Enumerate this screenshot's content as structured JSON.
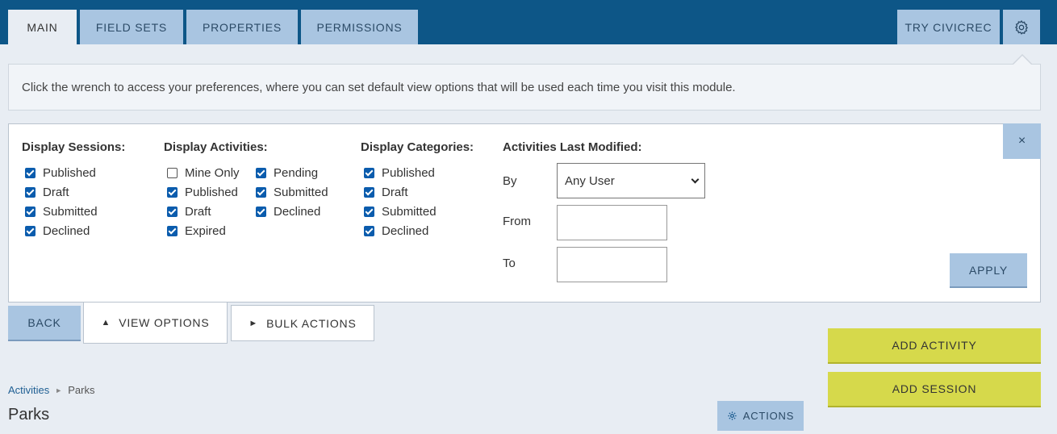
{
  "tabs": [
    {
      "label": "MAIN"
    },
    {
      "label": "FIELD SETS"
    },
    {
      "label": "PROPERTIES"
    },
    {
      "label": "PERMISSIONS"
    }
  ],
  "header": {
    "try_label": "TRY CIVICREC",
    "settings_icon": "gear-icon"
  },
  "notice": {
    "text": "Click the wrench to access your preferences, where you can set default view options that will be used each time you visit this module."
  },
  "view_options": {
    "close_label": "×",
    "sessions": {
      "title": "Display Sessions:",
      "items": [
        {
          "label": "Published",
          "checked": true
        },
        {
          "label": "Draft",
          "checked": true
        },
        {
          "label": "Submitted",
          "checked": true
        },
        {
          "label": "Declined",
          "checked": true
        }
      ]
    },
    "activities": {
      "title": "Display Activities:",
      "col1": [
        {
          "label": "Mine Only",
          "checked": false
        },
        {
          "label": "Published",
          "checked": true
        },
        {
          "label": "Draft",
          "checked": true
        },
        {
          "label": "Expired",
          "checked": true
        }
      ],
      "col2": [
        {
          "label": "Pending",
          "checked": true
        },
        {
          "label": "Submitted",
          "checked": true
        },
        {
          "label": "Declined",
          "checked": true
        }
      ]
    },
    "categories": {
      "title": "Display Categories:",
      "items": [
        {
          "label": "Published",
          "checked": true
        },
        {
          "label": "Draft",
          "checked": true
        },
        {
          "label": "Submitted",
          "checked": true
        },
        {
          "label": "Declined",
          "checked": true
        }
      ]
    },
    "modified": {
      "title": "Activities Last Modified:",
      "by_label": "By",
      "by_value": "Any User",
      "from_label": "From",
      "from_value": "",
      "to_label": "To",
      "to_value": ""
    },
    "apply_label": "APPLY"
  },
  "toolbar": {
    "back_label": "BACK",
    "view_options_label": "VIEW OPTIONS",
    "view_options_icon": "▲",
    "bulk_actions_label": "BULK ACTIONS",
    "bulk_actions_icon": "►"
  },
  "add_buttons": {
    "activity": "ADD ACTIVITY",
    "session": "ADD SESSION"
  },
  "breadcrumb": {
    "parent": "Activities",
    "separator": "►",
    "current": "Parks"
  },
  "page_title": "Parks",
  "actions_label": "ACTIONS",
  "colors": {
    "nav_bg": "#0d5687",
    "button_blue": "#a9c5e1",
    "accent_yellow": "#d6d94b",
    "checkbox": "#0b5cad"
  }
}
